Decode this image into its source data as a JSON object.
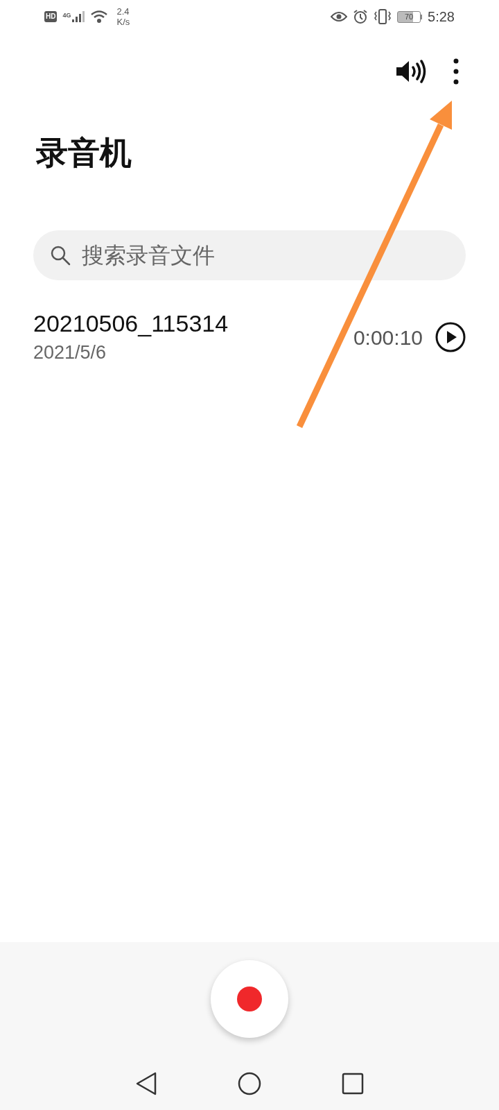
{
  "status_bar": {
    "hd": "HD",
    "network": "4G",
    "speed_value": "2.4",
    "speed_unit": "K/s",
    "battery": "70",
    "time": "5:28"
  },
  "title": "录音机",
  "search": {
    "placeholder": "搜索录音文件"
  },
  "recordings": [
    {
      "name": "20210506_115314",
      "date": "2021/5/6",
      "duration": "0:00:10"
    }
  ]
}
